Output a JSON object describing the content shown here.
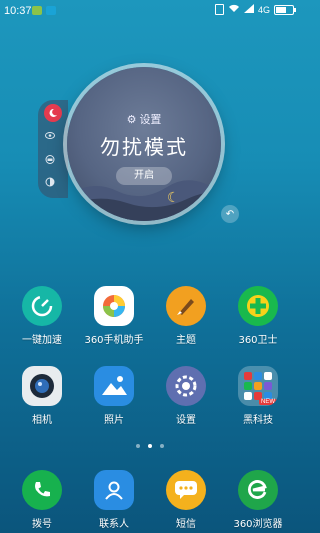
{
  "status": {
    "time": "10:37",
    "network": "4G",
    "battery_level": 0.6
  },
  "widget": {
    "settings_label": "设置",
    "mode_title": "勿扰模式",
    "open_button": "开启",
    "side_buttons": [
      {
        "icon": "moon-icon",
        "active": true
      },
      {
        "icon": "eye-icon",
        "active": false
      },
      {
        "icon": "car-icon",
        "active": false
      },
      {
        "icon": "contrast-icon",
        "active": false
      }
    ]
  },
  "apps": [
    {
      "label": "一键加速",
      "icon": "speedometer-icon",
      "color": "#16b7a6"
    },
    {
      "label": "360手机助手",
      "icon": "app-store-icon",
      "color": "#ffffff"
    },
    {
      "label": "主题",
      "icon": "paintbrush-icon",
      "color": "#f2a020"
    },
    {
      "label": "360卫士",
      "icon": "shield-plus-icon",
      "color": "#19b94d"
    },
    {
      "label": "相机",
      "icon": "camera-icon",
      "color": "#1d2a3a"
    },
    {
      "label": "照片",
      "icon": "photos-icon",
      "color": "#2a8de2"
    },
    {
      "label": "设置",
      "icon": "gear-icon",
      "color": "#5f6fb0"
    },
    {
      "label": "黑科技",
      "icon": "folder-icon",
      "color": "#4a9fd0"
    }
  ],
  "new_badge": "NEW",
  "pager": {
    "pages": 3,
    "current": 1
  },
  "dock": [
    {
      "label": "拨号",
      "icon": "phone-icon",
      "color": "#17b14e"
    },
    {
      "label": "联系人",
      "icon": "contacts-icon",
      "color": "#2a8de2"
    },
    {
      "label": "短信",
      "icon": "message-icon",
      "color": "#f4b11d"
    },
    {
      "label": "360浏览器",
      "icon": "browser-icon",
      "color": "#1fa64a"
    }
  ]
}
